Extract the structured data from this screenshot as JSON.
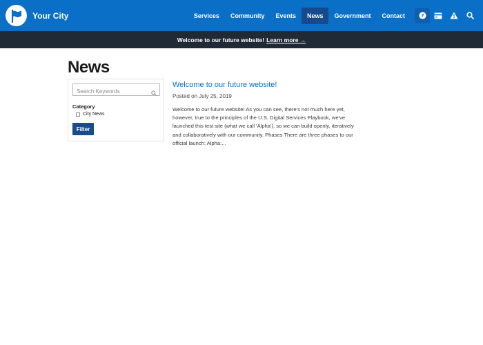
{
  "header": {
    "site_name": "Your City",
    "nav": [
      {
        "label": "Services"
      },
      {
        "label": "Community"
      },
      {
        "label": "Events"
      },
      {
        "label": "News",
        "active": true
      },
      {
        "label": "Government"
      },
      {
        "label": "Contact"
      }
    ],
    "icons": [
      "help-icon",
      "payment-card-icon",
      "alert-icon",
      "search-icon"
    ],
    "brand_color": "#0a6fc7",
    "active_color": "#164a8c"
  },
  "banner": {
    "text": "Welcome to our future website!",
    "link": "Learn more →"
  },
  "page": {
    "title": "News"
  },
  "filters": {
    "search_placeholder": "Search Keywords",
    "category_label": "Category",
    "options": [
      {
        "label": "City News",
        "checked": false
      }
    ],
    "button_label": "Filter"
  },
  "articles": [
    {
      "title": "Welcome to our future website!",
      "date": "Posted on July 25, 2019",
      "excerpt": "Welcome to our future website! As you can see, there's not much here yet, however, true to the principles of the U.S. Digital Services Playbook, we've launched this test site (what we call 'Alpha'), so we can build openly, iteratively and collaboratively with our community. Phases There are three phases to our official launch: Alpha:..."
    }
  ]
}
